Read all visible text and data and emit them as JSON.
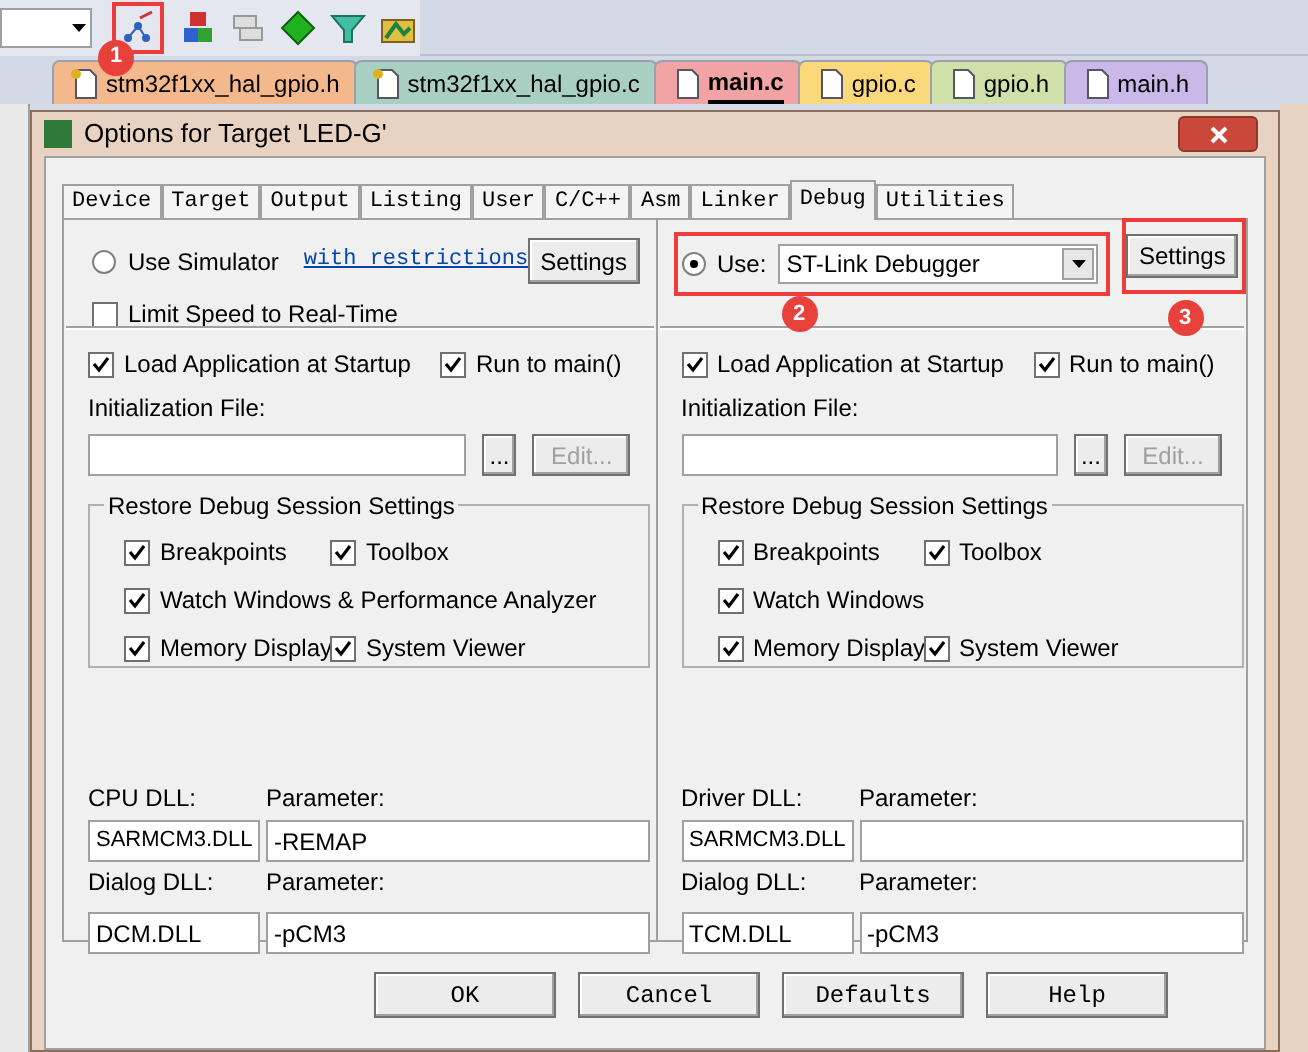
{
  "toolbar": {
    "marker": "1"
  },
  "file_tabs": [
    {
      "label": "stm32f1xx_hal_gpio.h",
      "selected": false,
      "color": "#f3b88c",
      "kind": "locked"
    },
    {
      "label": "stm32f1xx_hal_gpio.c",
      "selected": false,
      "color": "#a9cfc2",
      "kind": "locked"
    },
    {
      "label": "main.c",
      "selected": true,
      "color": "#f2a3a3",
      "kind": "plain"
    },
    {
      "label": "gpio.c",
      "selected": false,
      "color": "#fbd97a",
      "kind": "plain"
    },
    {
      "label": "gpio.h",
      "selected": false,
      "color": "#cfe0a8",
      "kind": "plain"
    },
    {
      "label": "main.h",
      "selected": false,
      "color": "#c9b8e8",
      "kind": "plain"
    }
  ],
  "dialog": {
    "title": "Options for Target 'LED-G'",
    "tabs": [
      {
        "label": "Device",
        "selected": false
      },
      {
        "label": "Target",
        "selected": false
      },
      {
        "label": "Output",
        "selected": false
      },
      {
        "label": "Listing",
        "selected": false
      },
      {
        "label": "User",
        "selected": false
      },
      {
        "label": "C/C++",
        "selected": false
      },
      {
        "label": "Asm",
        "selected": false
      },
      {
        "label": "Linker",
        "selected": false
      },
      {
        "label": "Debug",
        "selected": true
      },
      {
        "label": "Utilities",
        "selected": false
      }
    ],
    "panels": [
      {
        "mode": {
          "kind": "simulator",
          "label": "Use Simulator",
          "selected": false,
          "link": "with restrictions",
          "settings": "Settings",
          "limit": {
            "label": "Limit Speed to Real-Time",
            "checked": false
          }
        },
        "load": {
          "label": "Load Application at Startup",
          "checked": true
        },
        "run": {
          "label": "Run to main()",
          "checked": true
        },
        "init_label": "Initialization File:",
        "browse": "...",
        "edit": {
          "label": "Edit...",
          "disabled": true
        },
        "group": {
          "title": "Restore Debug Session Settings",
          "items": [
            {
              "label": "Breakpoints",
              "checked": true,
              "wide": false
            },
            {
              "label": "Toolbox",
              "checked": true,
              "wide": false
            },
            {
              "label": "Watch Windows & Performance Analyzer",
              "checked": true,
              "wide": true
            },
            {
              "label": "Memory Display",
              "checked": true,
              "wide": false
            },
            {
              "label": "System Viewer",
              "checked": true,
              "wide": false
            }
          ]
        },
        "dll": {
          "dll_label": "CPU DLL:",
          "param_label": "Parameter:",
          "dll": "SARMCM3.DLL",
          "param": "-REMAP",
          "dialog_label": "Dialog DLL:",
          "dialog_param_label": "Parameter:",
          "dialog_dll": "DCM.DLL",
          "dialog_param": "-pCM3"
        }
      },
      {
        "mode": {
          "kind": "target",
          "label": "Use:",
          "selected": true,
          "value": "ST-Link Debugger",
          "settings": "Settings",
          "markers": [
            "2",
            "3"
          ]
        },
        "load": {
          "label": "Load Application at Startup",
          "checked": true
        },
        "run": {
          "label": "Run to main()",
          "checked": true
        },
        "init_label": "Initialization File:",
        "browse": "...",
        "edit": {
          "label": "Edit...",
          "disabled": true
        },
        "group": {
          "title": "Restore Debug Session Settings",
          "items": [
            {
              "label": "Breakpoints",
              "checked": true,
              "wide": false
            },
            {
              "label": "Toolbox",
              "checked": true,
              "wide": false
            },
            {
              "label": "Watch Windows",
              "checked": true,
              "wide": true
            },
            {
              "label": "Memory Display",
              "checked": true,
              "wide": false
            },
            {
              "label": "System Viewer",
              "checked": true,
              "wide": false
            }
          ]
        },
        "dll": {
          "dll_label": "Driver DLL:",
          "param_label": "Parameter:",
          "dll": "SARMCM3.DLL",
          "dialog_label": "Dialog DLL:",
          "dialog_param_label": "Parameter:",
          "dialog_dll": "TCM.DLL",
          "dialog_param": "-pCM3"
        }
      }
    ],
    "buttons": [
      "OK",
      "Cancel",
      "Defaults",
      "Help"
    ]
  }
}
